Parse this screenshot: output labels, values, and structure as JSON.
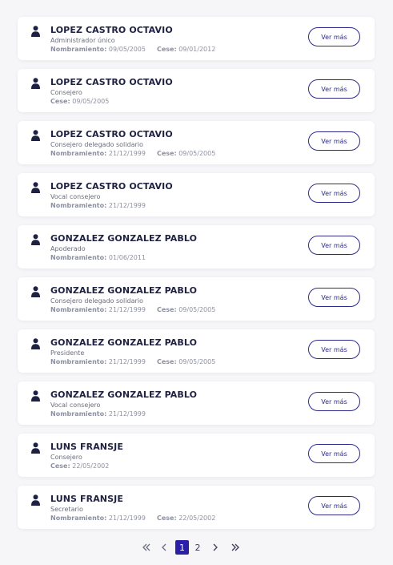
{
  "items": [
    {
      "name": "LOPEZ CASTRO OCTAVIO",
      "role": "Administrador único",
      "nombramiento_label": "Nombramiento:",
      "nombramiento": "09/05/2005",
      "cese_label": "Cese:",
      "cese": "09/01/2012",
      "button": "Ver más"
    },
    {
      "name": "LOPEZ CASTRO OCTAVIO",
      "role": "Consejero",
      "nombramiento_label": "",
      "nombramiento": "",
      "cese_label": "Cese:",
      "cese": "09/05/2005",
      "button": "Ver más"
    },
    {
      "name": "LOPEZ CASTRO OCTAVIO",
      "role": "Consejero delegado solidario",
      "nombramiento_label": "Nombramiento:",
      "nombramiento": "21/12/1999",
      "cese_label": "Cese:",
      "cese": "09/05/2005",
      "button": "Ver más"
    },
    {
      "name": "LOPEZ CASTRO OCTAVIO",
      "role": "Vocal consejero",
      "nombramiento_label": "Nombramiento:",
      "nombramiento": "21/12/1999",
      "cese_label": "",
      "cese": "",
      "button": "Ver más"
    },
    {
      "name": "GONZALEZ GONZALEZ PABLO",
      "role": "Apoderado",
      "nombramiento_label": "Nombramiento:",
      "nombramiento": "01/06/2011",
      "cese_label": "",
      "cese": "",
      "button": "Ver más"
    },
    {
      "name": "GONZALEZ GONZALEZ PABLO",
      "role": "Consejero delegado solidario",
      "nombramiento_label": "Nombramiento:",
      "nombramiento": "21/12/1999",
      "cese_label": "Cese:",
      "cese": "09/05/2005",
      "button": "Ver más"
    },
    {
      "name": "GONZALEZ GONZALEZ PABLO",
      "role": "Presidente",
      "nombramiento_label": "Nombramiento:",
      "nombramiento": "21/12/1999",
      "cese_label": "Cese:",
      "cese": "09/05/2005",
      "button": "Ver más"
    },
    {
      "name": "GONZALEZ GONZALEZ PABLO",
      "role": "Vocal consejero",
      "nombramiento_label": "Nombramiento:",
      "nombramiento": "21/12/1999",
      "cese_label": "",
      "cese": "",
      "button": "Ver más"
    },
    {
      "name": "LUNS FRANSJE",
      "role": "Consejero",
      "nombramiento_label": "",
      "nombramiento": "",
      "cese_label": "Cese:",
      "cese": "22/05/2002",
      "button": "Ver más"
    },
    {
      "name": "LUNS FRANSJE",
      "role": "Secretario",
      "nombramiento_label": "Nombramiento:",
      "nombramiento": "21/12/1999",
      "cese_label": "Cese:",
      "cese": "22/05/2002",
      "button": "Ver más"
    }
  ],
  "pagination": {
    "first_icon": "double-chevron-left-icon",
    "prev_icon": "chevron-left-icon",
    "pages": [
      "1",
      "2"
    ],
    "current": "1",
    "next_icon": "chevron-right-icon",
    "last_icon": "double-chevron-right-icon"
  },
  "colors": {
    "accent": "#2a1fa6",
    "button_border": "#2d2a8c",
    "name": "#1f2142",
    "muted": "#8d90a0"
  }
}
